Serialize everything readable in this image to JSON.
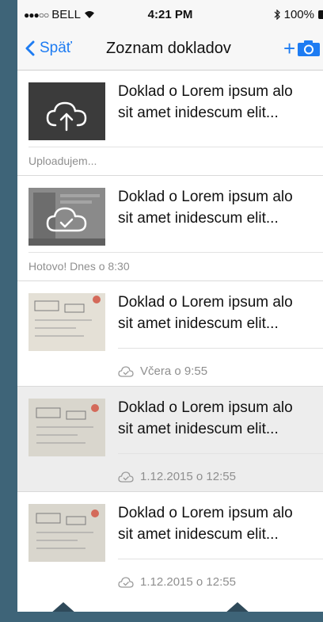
{
  "status_bar": {
    "carrier": "BELL",
    "time": "4:21 PM",
    "battery": "100%"
  },
  "nav": {
    "back_label": "Späť",
    "title": "Zoznam dokladov",
    "add_label": "+"
  },
  "items": [
    {
      "title_line1": "Doklad o Lorem ipsum alo",
      "title_line2": "sit amet inidescum elit...",
      "status": "Uploadujem...",
      "status_icon": ""
    },
    {
      "title_line1": "Doklad o Lorem ipsum alo",
      "title_line2": "sit amet inidescum elit...",
      "status": "Hotovo! Dnes o 8:30",
      "status_icon": ""
    },
    {
      "title_line1": "Doklad o Lorem ipsum alo",
      "title_line2": "sit amet inidescum elit...",
      "status": "Včera o 9:55",
      "status_icon": "cloud-check-icon"
    },
    {
      "title_line1": "Doklad o Lorem ipsum alo",
      "title_line2": "sit amet inidescum elit...",
      "status": "1.12.2015 o 12:55",
      "status_icon": "cloud-check-icon"
    },
    {
      "title_line1": "Doklad o Lorem ipsum alo",
      "title_line2": "sit amet inidescum elit...",
      "status": "1.12.2015 o 12:55",
      "status_icon": "cloud-check-icon"
    }
  ],
  "colors": {
    "accent": "#1e7cf2",
    "background": "#3e6478"
  }
}
